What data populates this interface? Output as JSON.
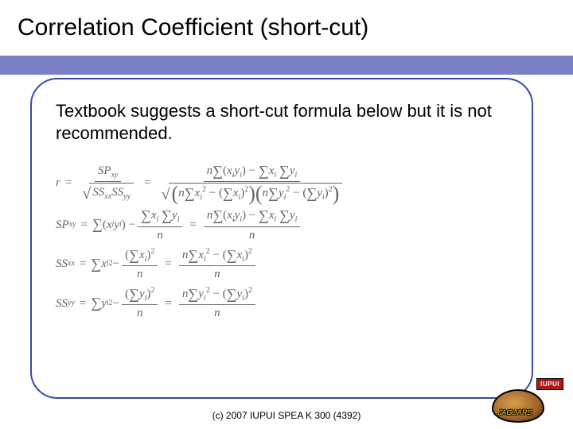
{
  "title": "Correlation Coefficient (short-cut)",
  "body": "Textbook suggests a short-cut formula below but it is not recommended.",
  "formula": {
    "r_lhs": "r",
    "sp_xy": "SP",
    "sp_sub": "xy",
    "ss_xx": "SS",
    "ss_xx_sub": "xx",
    "ss_yy": "SS",
    "ss_yy_sub": "yy",
    "n": "n",
    "xi": "x",
    "yi": "y",
    "i": "i",
    "two": "2"
  },
  "footer": "(c) 2007 IUPUI SPEA K 300 (4392)",
  "logo": {
    "org": "IUPUI",
    "team": "JAGUARS"
  }
}
